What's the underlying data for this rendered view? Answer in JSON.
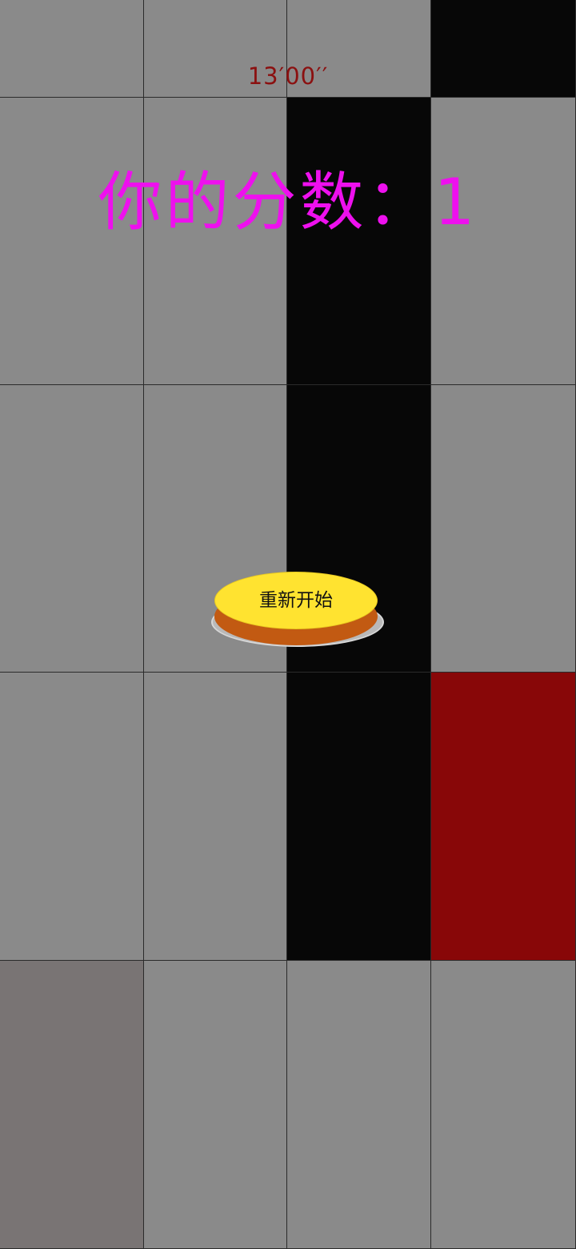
{
  "game": {
    "timer": "13′00′′",
    "score_text": "你的分数：1",
    "restart_label": "重新开始",
    "grid": {
      "columns": 4,
      "rows": [
        [
          "gray",
          "gray",
          "gray",
          "black"
        ],
        [
          "gray",
          "gray",
          "black",
          "gray"
        ],
        [
          "gray",
          "gray",
          "black",
          "gray"
        ],
        [
          "gray",
          "gray",
          "black",
          "red"
        ],
        [
          "dim",
          "gray",
          "gray",
          "gray"
        ]
      ]
    },
    "colors": {
      "tile_gray": "#8a8a8a",
      "tile_black": "#070707",
      "tile_red": "#880708",
      "tile_dim": "#797474",
      "score_text": "#ee10ee",
      "timer_text": "#8b1010",
      "button_top": "#ffe330",
      "button_side": "#c25a12"
    }
  }
}
